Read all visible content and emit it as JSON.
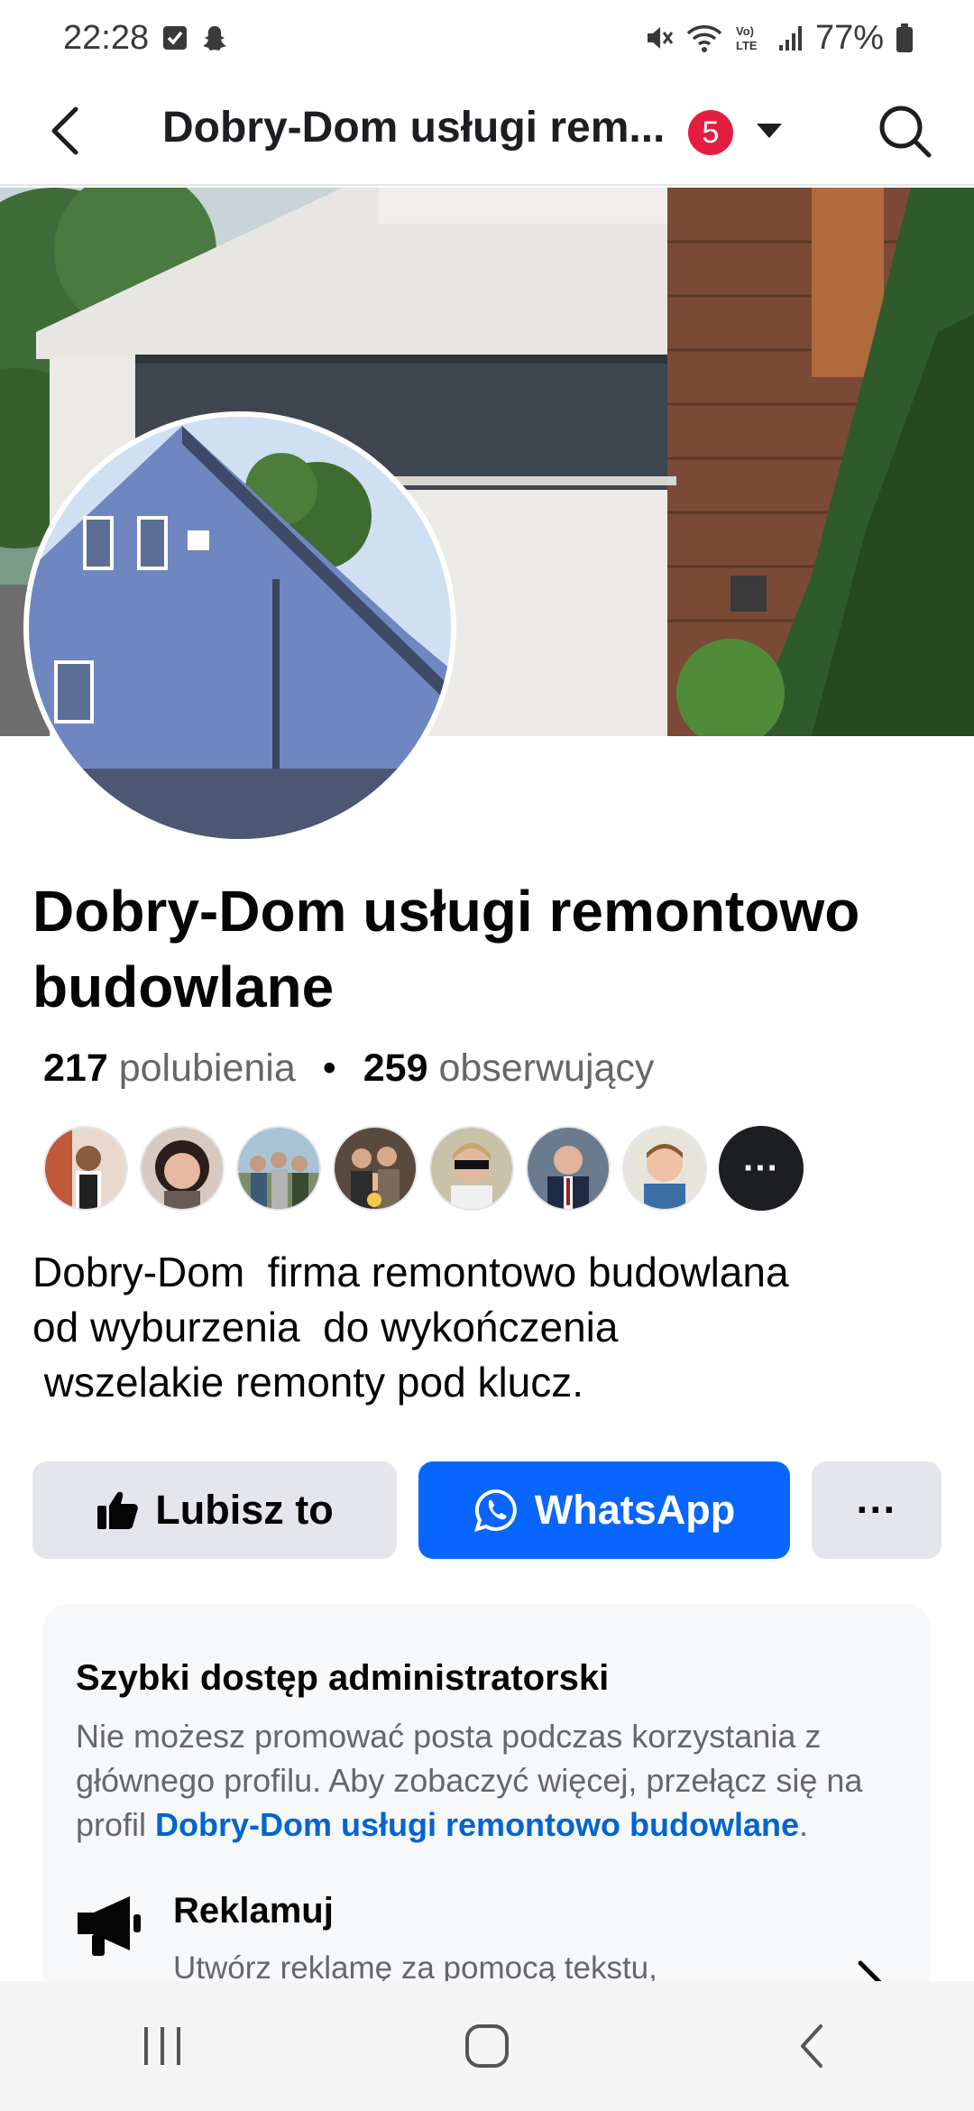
{
  "status_bar": {
    "time": "22:28",
    "battery": "77%",
    "icons": [
      "checkbox-notification-icon",
      "snapchat-icon",
      "mute-icon",
      "wifi-icon",
      "volte-icon",
      "signal-icon",
      "battery-icon"
    ]
  },
  "header": {
    "title": "Dobry-Dom  usługi rem...",
    "badge_count": "5",
    "icons": [
      "back-arrow-icon",
      "caret-down-icon",
      "search-icon"
    ]
  },
  "page": {
    "name": "Dobry-Dom  usługi remontowo budowlane",
    "likes_count": "217",
    "likes_label": "polubienia",
    "separator": "•",
    "followers_count": "259",
    "followers_label": "obserwujący",
    "friends_more": "···",
    "bio": "Dobry-Dom  firma remontowo budowlana\nod wyburzenia  do wykończenia\n wszelakie remonty pod klucz."
  },
  "actions": {
    "like_label": "Lubisz to",
    "whatsapp_label": "WhatsApp",
    "more_label": "···"
  },
  "admin": {
    "title": "Szybki dostęp administratorski",
    "desc_prefix": "Nie możesz promować posta podczas korzystania z głównego profilu. Aby zobaczyć więcej, przełącz się na profil ",
    "desc_link": "Dobry-Dom  usługi remontowo budowlane",
    "desc_suffix": ".",
    "promote_title": "Reklamuj",
    "promote_sub": "Utwórz reklamę za pomocą tekstu,"
  },
  "colors": {
    "accent": "#0866ff",
    "badge": "#e41e3f",
    "link": "#0064d1",
    "secondary_text": "#65676b",
    "button_grey": "#e4e6eb"
  }
}
